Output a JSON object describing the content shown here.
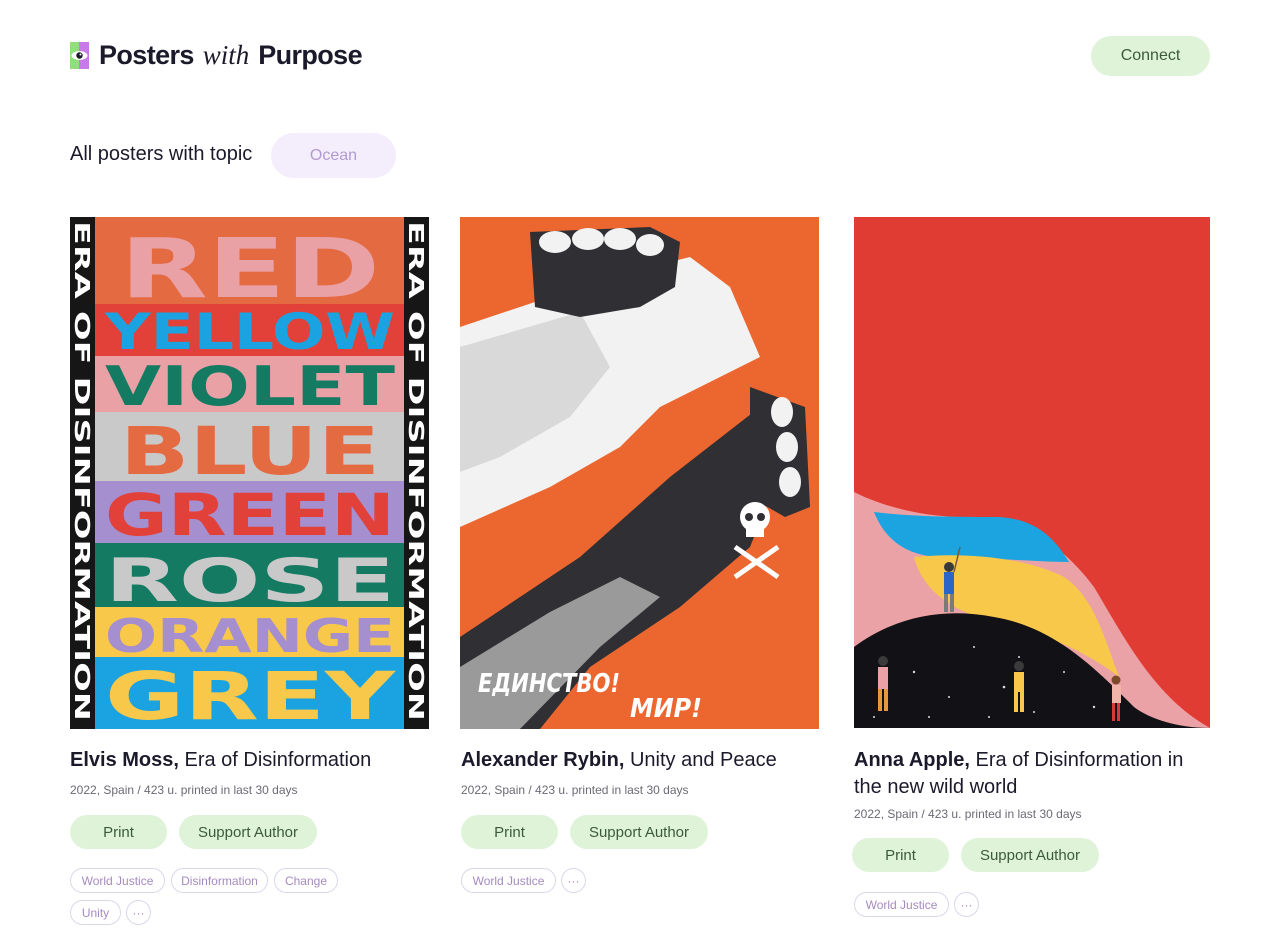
{
  "header": {
    "logo": {
      "word1": "Posters",
      "word2": "with",
      "word3": "Purpose"
    },
    "connect_label": "Connect"
  },
  "topic": {
    "label": "All posters with topic",
    "value": "Ocean"
  },
  "colors": {
    "accent_green": "#dff3d9",
    "accent_purple": "#f4eefc",
    "text": "#1b1a2b"
  },
  "posters": [
    {
      "author": "Elvis Moss,",
      "title": "Era of Disinformation",
      "meta": "2022, Spain / 423 u. printed in last 30 days",
      "print_label": "Print",
      "support_label": "Support Author",
      "tags": [
        "World Justice",
        "Disinformation",
        "Change",
        "Unity"
      ],
      "more_label": "···",
      "artwork": {
        "side_text": "ERA OF DISINFORMATION",
        "words": [
          "RED",
          "YELLOW",
          "VIOLET",
          "BLUE",
          "GREEN",
          "ROSE",
          "ORANGE",
          "GREY"
        ]
      }
    },
    {
      "author": "Alexander Rybin,",
      "title": "Unity and Peace",
      "meta": "2022, Spain / 423 u. printed in last 30 days",
      "print_label": "Print",
      "support_label": "Support Author",
      "tags": [
        "World Justice"
      ],
      "more_label": "···",
      "artwork": {
        "slogan1": "ЕДИНСТВО!",
        "slogan2": "МИР!"
      }
    },
    {
      "author": "Anna Apple,",
      "title": "Era of Disinformation in the new wild world",
      "meta": "2022, Spain / 423 u. printed in last 30 days",
      "print_label": "Print",
      "support_label": "Support Author",
      "tags": [
        "World Justice"
      ],
      "more_label": "···"
    }
  ]
}
